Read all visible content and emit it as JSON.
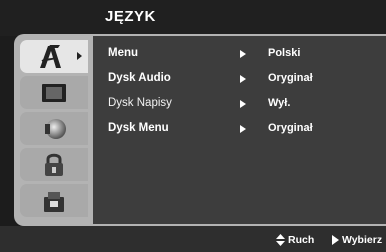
{
  "header": {
    "title": "JĘZYK"
  },
  "tabs": [
    {
      "name": "language",
      "icon": "language-icon",
      "active": true
    },
    {
      "name": "display",
      "icon": "display-icon",
      "active": false
    },
    {
      "name": "audio",
      "icon": "speaker-icon",
      "active": false
    },
    {
      "name": "lock",
      "icon": "padlock-icon",
      "active": false
    },
    {
      "name": "other",
      "icon": "settings-icon",
      "active": false
    }
  ],
  "menu": {
    "rows": [
      {
        "label": "Menu",
        "value": "Polski"
      },
      {
        "label": "Dysk Audio",
        "value": "Oryginał"
      },
      {
        "label": "Dysk Napisy",
        "value": "Wył."
      },
      {
        "label": "Dysk Menu",
        "value": "Oryginał"
      }
    ]
  },
  "footer": {
    "move_label": "Ruch",
    "select_label": "Wybierz"
  },
  "colors": {
    "background": "#1c1c1c",
    "panel": "#3d3d3d",
    "tab_active": "#e6e6e6",
    "tab": "#a9a9a9",
    "frame": "#b3b3b3"
  }
}
